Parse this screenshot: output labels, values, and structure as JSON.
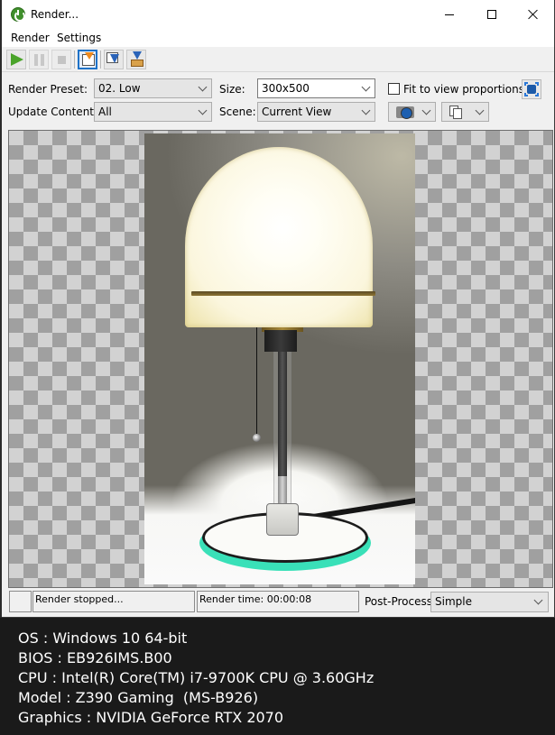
{
  "window": {
    "title": "Render...",
    "icon": "power-icon",
    "controls": {
      "minimize": "minimize-icon",
      "maximize": "maximize-icon",
      "close": "close-icon"
    }
  },
  "menu": {
    "items": [
      {
        "label": "Render"
      },
      {
        "label": "Settings"
      }
    ]
  },
  "toolbar": {
    "buttons": [
      {
        "name": "start-render",
        "icon": "play-icon",
        "enabled": true
      },
      {
        "name": "pause-render",
        "icon": "pause-icon",
        "enabled": false
      },
      {
        "name": "stop-render",
        "icon": "stop-icon",
        "enabled": false
      },
      {
        "name": "save-to-file",
        "icon": "save-image-icon",
        "active": true
      },
      {
        "name": "copy-to-clipboard",
        "icon": "copy-image-icon"
      },
      {
        "name": "export",
        "icon": "export-box-icon"
      }
    ]
  },
  "settings": {
    "render_preset_label": "Render Preset:",
    "render_preset_value": "02. Low",
    "update_content_label": "Update Content:",
    "update_content_value": "All",
    "size_label": "Size:",
    "size_value": "300x500",
    "scene_label": "Scene:",
    "scene_value": "Current View",
    "fit_to_view_label": "Fit to view proportions",
    "fit_to_view_checked": false
  },
  "render": {
    "subject": "Desk lamp with glowing globe shade on glass base",
    "resolution": "300x500"
  },
  "status": {
    "state": "Render stopped...",
    "render_time": "Render time: 00:00:08",
    "post_process_label": "Post-Process:",
    "post_process_value": "Simple"
  },
  "system_info": [
    "OS : Windows 10 64-bit",
    "BIOS : EB926IMS.B00",
    "CPU : Intel(R) Core(TM) i7-9700K CPU @ 3.60GHz",
    "Model : Z390 Gaming  (MS-B926)",
    "Graphics : NVIDIA GeForce RTX 2070"
  ],
  "colors": {
    "accent": "#1e72c8",
    "play_green": "#4aa42a",
    "glow_cyan": "#39e0b8"
  }
}
